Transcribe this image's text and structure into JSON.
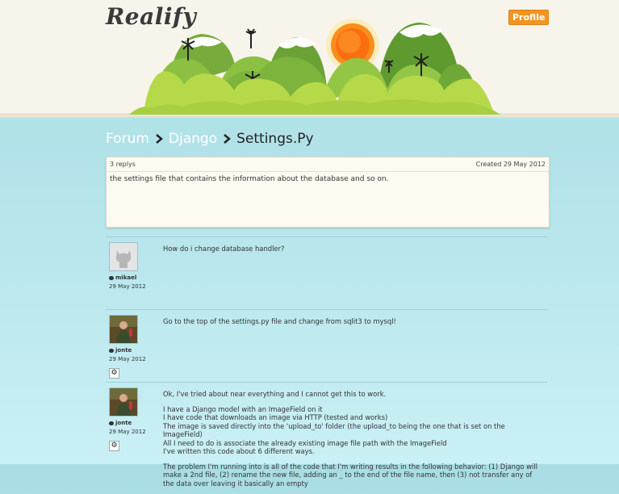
{
  "header": {
    "logo": "Realify",
    "profile_label": "Profile"
  },
  "breadcrumb": {
    "items": [
      "Forum",
      "Django"
    ],
    "current": "Settings.Py"
  },
  "topic": {
    "replies": "3 replys",
    "created": "Created 29 May 2012",
    "body": "the settings file that contains the information about the database and so on."
  },
  "replies": [
    {
      "author": "mikael",
      "date": "29 May 2012",
      "avatar_icon": "octocat-default-avatar",
      "paragraphs": [
        "How do i change database handler?"
      ]
    },
    {
      "author": "jonte",
      "date": "29 May 2012",
      "avatar_icon": "user-photo-avatar",
      "paragraphs": [
        "Go to the top of the settings.py file and change from sqlit3 to mysql!"
      ]
    },
    {
      "author": "jonte",
      "date": "29 May 2012",
      "avatar_icon": "user-photo-avatar",
      "paragraphs": [
        "Ok, I've tried about near everything and I cannot get this to work.",
        "I have a Django model with an ImageField on it\nI have code that downloads an image via HTTP (tested and works)\nThe image is saved directly into the 'upload_to' folder (the upload_to being the one that is set on the ImageField)\nAll I need to do is associate the already existing image file path with the ImageField\nI've written this code about 6 different ways.",
        "The problem I'm running into is all of the code that I'm writing results in the following behavior: (1) Django will make a 2nd file, (2) rename the new file, adding an _ to the end of the file name, then (3) not transfer any of the data over leaving it basically an empty"
      ]
    }
  ],
  "colors": {
    "accent_orange": "#f29423",
    "background_top": "#a9dde4",
    "card_bg": "#fdfaf1"
  }
}
